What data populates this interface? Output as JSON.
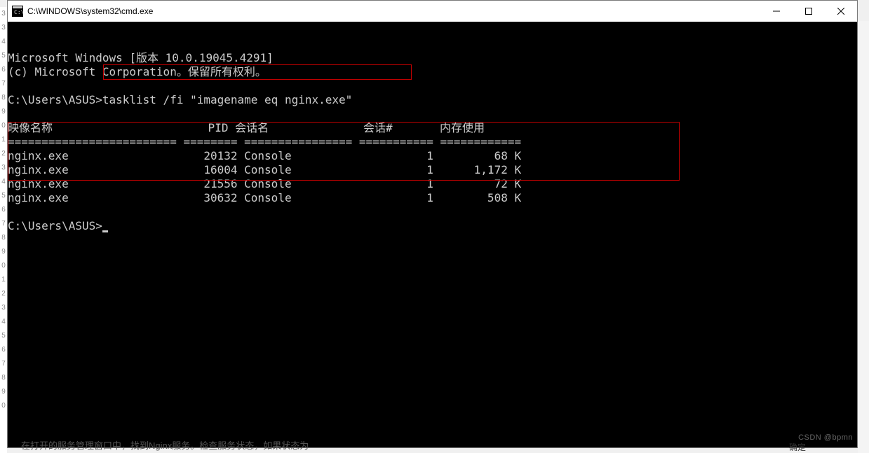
{
  "window": {
    "title": "C:\\WINDOWS\\system32\\cmd.exe"
  },
  "terminal": {
    "line1": "Microsoft Windows [版本 10.0.19045.4291]",
    "line2": "(c) Microsoft Corporation。保留所有权利。",
    "prompt1": "C:\\Users\\ASUS>",
    "command": "tasklist /fi \"imagename eq nginx.exe\"",
    "header": "映像名称                       PID 会话名              会话#       内存使用",
    "separator": "========================= ======== ================ =========== ============",
    "rows": [
      {
        "name": "nginx.exe",
        "pid": "20132",
        "session": "Console",
        "snum": "1",
        "mem": "68 K"
      },
      {
        "name": "nginx.exe",
        "pid": "16004",
        "session": "Console",
        "snum": "1",
        "mem": "1,172 K"
      },
      {
        "name": "nginx.exe",
        "pid": "21556",
        "session": "Console",
        "snum": "1",
        "mem": "72 K"
      },
      {
        "name": "nginx.exe",
        "pid": "30632",
        "session": "Console",
        "snum": "1",
        "mem": "508 K"
      }
    ],
    "prompt2": "C:\\Users\\ASUS>"
  },
  "watermark": "CSDN @bpmn",
  "left_numbers": [
    "3",
    "",
    "",
    "",
    "",
    "",
    "3",
    "4",
    "5",
    "6",
    "7",
    "8",
    "9",
    "0",
    "1",
    "2",
    "3",
    "4",
    "5",
    "6",
    "7",
    "8",
    "9",
    "0",
    "1",
    "2",
    "3",
    "4",
    "5",
    "6",
    "7",
    "8",
    "9",
    "0"
  ],
  "bg": {
    "partial_text": "在打开的服务管理窗口中，找到Nginx服务。检查服务状态，如果状态为",
    "confirm": "确定"
  }
}
